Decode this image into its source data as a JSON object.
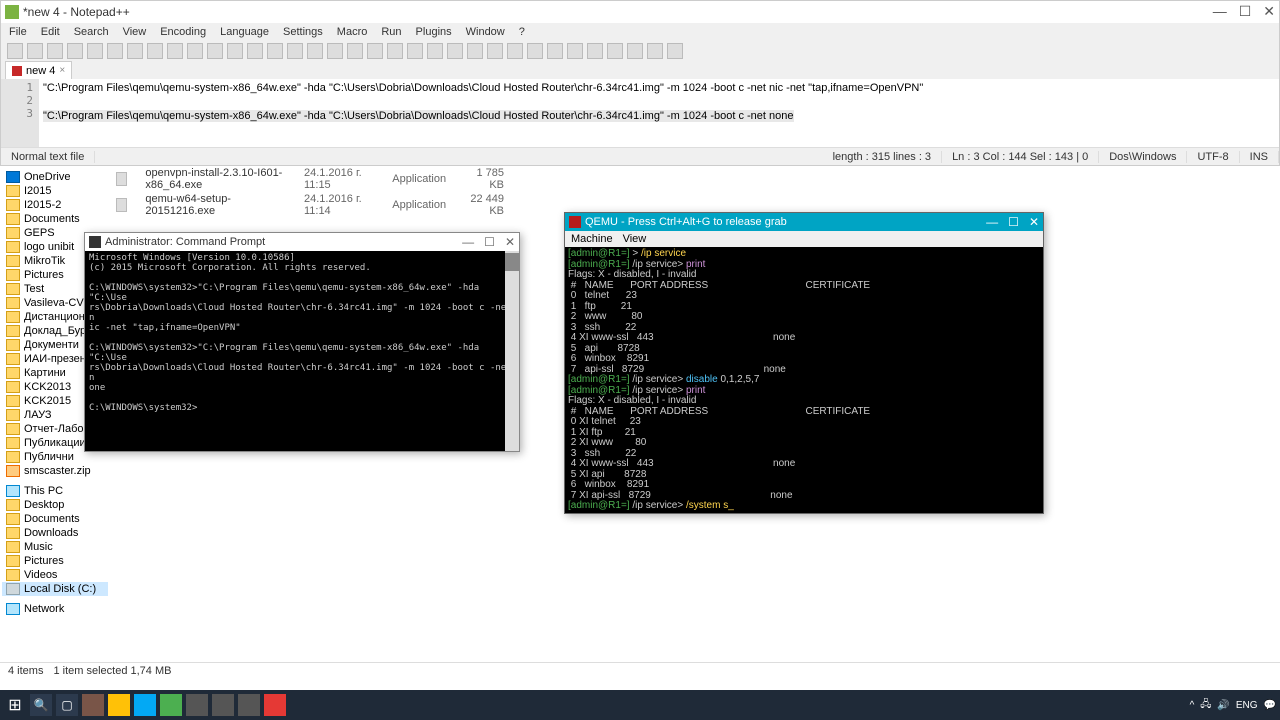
{
  "npp": {
    "title": "*new 4 - Notepad++",
    "menu": [
      "File",
      "Edit",
      "Search",
      "View",
      "Encoding",
      "Language",
      "Settings",
      "Macro",
      "Run",
      "Plugins",
      "Window",
      "?"
    ],
    "tab": "new 4",
    "lines": {
      "l1": "\"C:\\Program Files\\qemu\\qemu-system-x86_64w.exe\" -hda \"C:\\Users\\Dobria\\Downloads\\Cloud Hosted Router\\chr-6.34rc41.img\" -m 1024 -boot c -net nic -net \"tap,ifname=OpenVPN\"",
      "l2": "",
      "l3": "\"C:\\Program Files\\qemu\\qemu-system-x86_64w.exe\" -hda \"C:\\Users\\Dobria\\Downloads\\Cloud Hosted Router\\chr-6.34rc41.img\" -m 1024 -boot c -net none"
    },
    "status": {
      "type": "Normal text file",
      "len": "length : 315    lines : 3",
      "pos": "Ln : 3    Col : 144    Sel : 143 | 0",
      "eol": "Dos\\Windows",
      "enc": "UTF-8",
      "ins": "INS"
    }
  },
  "explorer": {
    "side_top": [
      "OneDrive",
      "I2015",
      "I2015-2",
      "Documents",
      "GEPS",
      "logo unibit",
      "MikroTik",
      "Pictures",
      "Test",
      "Vasileva-CV",
      "Дистанционно",
      "Доклад_Бург",
      "Документи",
      "ИАИ-презен",
      "Картини",
      "KCK2013",
      "KCK2015",
      "ЛАУЗ",
      "Отчет-Лаборатор",
      "Публикации",
      "Публични",
      "smscaster.zip"
    ],
    "side_pc": [
      "This PC",
      "Desktop",
      "Documents",
      "Downloads",
      "Music",
      "Pictures",
      "Videos",
      "Local Disk (C:)"
    ],
    "side_net": "Network",
    "files": [
      {
        "name": "openvpn-install-2.3.10-I601-x86_64.exe",
        "date": "24.1.2016 г. 11:15",
        "type": "Application",
        "size": "1 785 KB"
      },
      {
        "name": "qemu-w64-setup-20151216.exe",
        "date": "24.1.2016 г. 11:14",
        "type": "Application",
        "size": "22 449 KB"
      }
    ],
    "status_items": "4 items",
    "status_sel": "1 item selected  1,74 MB"
  },
  "cmd": {
    "title": "Administrator: Command Prompt",
    "body": "Microsoft Windows [Version 10.0.10586]\n(c) 2015 Microsoft Corporation. All rights reserved.\n\nC:\\WINDOWS\\system32>\"C:\\Program Files\\qemu\\qemu-system-x86_64w.exe\" -hda \"C:\\Use\nrs\\Dobria\\Downloads\\Cloud Hosted Router\\chr-6.34rc41.img\" -m 1024 -boot c -net n\nic -net \"tap,ifname=OpenVPN\"\n\nC:\\WINDOWS\\system32>\"C:\\Program Files\\qemu\\qemu-system-x86_64w.exe\" -hda \"C:\\Use\nrs\\Dobria\\Downloads\\Cloud Hosted Router\\chr-6.34rc41.img\" -m 1024 -boot c -net n\none\n\nC:\\WINDOWS\\system32>"
  },
  "qemu": {
    "title": "QEMU - Press Ctrl+Alt+G to release grab",
    "menu": [
      "Machine",
      "View"
    ],
    "lines": [
      {
        "t": "[admin@R1=] > /ip service",
        "cls": "g"
      },
      {
        "t": "[admin@R1=] /ip service> print",
        "cls": "gp"
      },
      {
        "t": "Flags: X - disabled, I - invalid",
        "cls": ""
      },
      {
        "t": " #   NAME      PORT ADDRESS                                   CERTIFICATE",
        "cls": ""
      },
      {
        "t": " 0   telnet      23",
        "cls": ""
      },
      {
        "t": " 1   ftp         21",
        "cls": ""
      },
      {
        "t": " 2   www         80",
        "cls": ""
      },
      {
        "t": " 3   ssh         22",
        "cls": ""
      },
      {
        "t": " 4 XI www-ssl   443                                           none",
        "cls": ""
      },
      {
        "t": " 5   api       8728",
        "cls": ""
      },
      {
        "t": " 6   winbox    8291",
        "cls": ""
      },
      {
        "t": " 7   api-ssl   8729                                           none",
        "cls": ""
      },
      {
        "t": "[admin@R1=] /ip service> disable 0,1,2,5,7",
        "cls": "gc"
      },
      {
        "t": "[admin@R1=] /ip service> print",
        "cls": "gp"
      },
      {
        "t": "Flags: X - disabled, I - invalid",
        "cls": ""
      },
      {
        "t": " #   NAME      PORT ADDRESS                                   CERTIFICATE",
        "cls": ""
      },
      {
        "t": " 0 XI telnet     23",
        "cls": ""
      },
      {
        "t": " 1 XI ftp        21",
        "cls": ""
      },
      {
        "t": " 2 XI www        80",
        "cls": ""
      },
      {
        "t": " 3   ssh         22",
        "cls": ""
      },
      {
        "t": " 4 XI www-ssl   443                                           none",
        "cls": ""
      },
      {
        "t": " 5 XI api       8728",
        "cls": ""
      },
      {
        "t": " 6   winbox    8291",
        "cls": ""
      },
      {
        "t": " 7 XI api-ssl   8729                                           none",
        "cls": ""
      },
      {
        "t": "[admin@R1=] /ip service> /system s_",
        "cls": "gy"
      }
    ]
  },
  "tray": {
    "lang": "ENG",
    "time": ""
  }
}
